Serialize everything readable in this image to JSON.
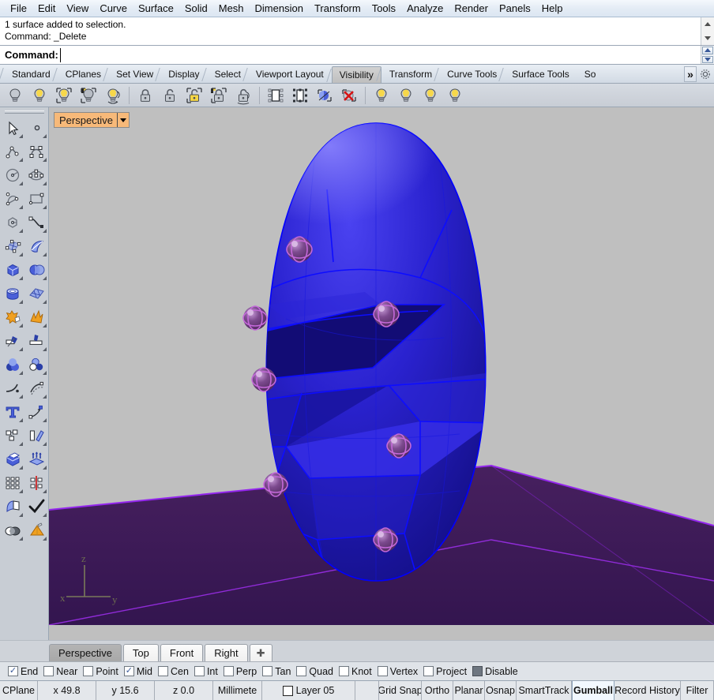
{
  "menu": {
    "items": [
      "File",
      "Edit",
      "View",
      "Curve",
      "Surface",
      "Solid",
      "Mesh",
      "Dimension",
      "Transform",
      "Tools",
      "Analyze",
      "Render",
      "Panels",
      "Help"
    ]
  },
  "command_area": {
    "history": [
      "1 surface added to selection.",
      "Command: _Delete"
    ],
    "prompt_label": "Command:",
    "input_value": "",
    "input_placeholder": "",
    "scroll_up_icon": "triangle-up-icon",
    "scroll_down_icon": "triangle-down-icon"
  },
  "toolbar_tabs": {
    "items": [
      {
        "label": "Standard",
        "active": false
      },
      {
        "label": "CPlanes",
        "active": false
      },
      {
        "label": "Set View",
        "active": false
      },
      {
        "label": "Display",
        "active": false
      },
      {
        "label": "Select",
        "active": false
      },
      {
        "label": "Viewport Layout",
        "active": false
      },
      {
        "label": "Visibility",
        "active": true
      },
      {
        "label": "Transform",
        "active": false
      },
      {
        "label": "Curve Tools",
        "active": false
      },
      {
        "label": "Surface Tools",
        "active": false
      },
      {
        "label": "So",
        "active": false,
        "clipped": true
      }
    ],
    "overflow_label": "»",
    "gear_icon": "gear-icon"
  },
  "visibility_toolbar": {
    "buttons": [
      {
        "name": "hide-objects",
        "icon": "bulb-grey-icon"
      },
      {
        "name": "show-objects",
        "icon": "bulb-yellow-icon"
      },
      {
        "name": "show-selected",
        "icon": "bulb-yellow-bracket-icon"
      },
      {
        "name": "hide-swap",
        "icon": "bulb-halfdark-icon"
      },
      {
        "name": "hide-swap-toggle",
        "icon": "bulb-swap-icon"
      },
      {
        "name": "lock-objects",
        "icon": "lock-closed-icon"
      },
      {
        "name": "unlock-objects",
        "icon": "lock-open-icon"
      },
      {
        "name": "unlock-selected",
        "icon": "lock-yellow-icon"
      },
      {
        "name": "lock-half",
        "icon": "lock-halfdark-icon"
      },
      {
        "name": "lock-swap",
        "icon": "lock-swap-icon"
      },
      {
        "name": "isolate-objects",
        "icon": "isolate-icon"
      },
      {
        "name": "unisolate-objects",
        "icon": "unisolate-icon"
      },
      {
        "name": "show-control-points",
        "icon": "points-on-icon"
      },
      {
        "name": "hide-control-points",
        "icon": "points-off-icon"
      },
      {
        "name": "bulb-extra-1",
        "icon": "bulb-yellow-icon"
      },
      {
        "name": "bulb-extra-2",
        "icon": "bulb-yellow-icon"
      },
      {
        "name": "bulb-extra-3",
        "icon": "bulb-yellow-icon"
      },
      {
        "name": "bulb-extra-4",
        "icon": "bulb-yellow-icon"
      }
    ]
  },
  "tool_palette": {
    "rows": [
      [
        {
          "name": "select-tool",
          "icon": "arrow-cursor-icon"
        },
        {
          "name": "point-tool",
          "icon": "point-icon"
        }
      ],
      [
        {
          "name": "polyline-tool",
          "icon": "polyline-icon"
        },
        {
          "name": "curve-control-points-tool",
          "icon": "nurbs-curve-icon"
        }
      ],
      [
        {
          "name": "circle-tool",
          "icon": "circle-icon"
        },
        {
          "name": "ellipse-tool",
          "icon": "ellipse-icon"
        }
      ],
      [
        {
          "name": "arc-tool",
          "icon": "arc-icon"
        },
        {
          "name": "rectangle-tool",
          "icon": "rectangle-icon"
        }
      ],
      [
        {
          "name": "polygon-tool",
          "icon": "polygon-icon"
        },
        {
          "name": "free-form-curve-tool",
          "icon": "bezier-icon"
        }
      ],
      [
        {
          "name": "surface-from-points-tool",
          "icon": "surface-points-icon"
        },
        {
          "name": "surface-sweep-tool",
          "icon": "sweep-surface-icon"
        }
      ],
      [
        {
          "name": "box-tool",
          "icon": "box-icon"
        },
        {
          "name": "sphere-boolean-tool",
          "icon": "boolean-spheres-icon"
        }
      ],
      [
        {
          "name": "cylinder-tool",
          "icon": "cylinder-icon"
        },
        {
          "name": "mesh-tool",
          "icon": "mesh-plane-icon"
        }
      ],
      [
        {
          "name": "explode-tool",
          "icon": "explode-star-icon"
        },
        {
          "name": "blast-tool",
          "icon": "blast-icon"
        }
      ],
      [
        {
          "name": "trim-tool",
          "icon": "trim-icon"
        },
        {
          "name": "split-tool",
          "icon": "split-icon"
        }
      ],
      [
        {
          "name": "boolean-union-tool",
          "icon": "boolean-union-icon"
        },
        {
          "name": "boolean-difference-tool",
          "icon": "boolean-diff-icon"
        }
      ],
      [
        {
          "name": "fillet-curve-tool",
          "icon": "fillet-curve-icon"
        },
        {
          "name": "offset-curve-tool",
          "icon": "offset-curve-icon"
        }
      ],
      [
        {
          "name": "text-tool",
          "icon": "text-t-icon"
        },
        {
          "name": "scale-tool",
          "icon": "scale-arrow-icon"
        }
      ],
      [
        {
          "name": "group-tool",
          "icon": "group-icon"
        },
        {
          "name": "mirror-tool",
          "icon": "mirror-icon"
        }
      ],
      [
        {
          "name": "cap-tool",
          "icon": "cap-solid-icon"
        },
        {
          "name": "extrude-tool",
          "icon": "extrude-up-icon"
        }
      ],
      [
        {
          "name": "array-tool",
          "icon": "array-grid-icon"
        },
        {
          "name": "array-polar-tool",
          "icon": "array-axis-icon"
        }
      ],
      [
        {
          "name": "unroll-tool",
          "icon": "unroll-surface-icon"
        },
        {
          "name": "check-tool",
          "icon": "check-mark-icon"
        }
      ],
      [
        {
          "name": "shade-tool",
          "icon": "shade-objects-icon"
        },
        {
          "name": "render-tool",
          "icon": "render-pyramid-icon"
        }
      ]
    ]
  },
  "viewport": {
    "label": "Perspective",
    "dropdown_icon": "chevron-down-icon",
    "axis_labels": {
      "x": "x",
      "y": "y",
      "z": "z"
    },
    "colors": {
      "background": "#bfbfbf",
      "ground_plane": "#3d1a5c",
      "ground_edge": "#9426ee",
      "surface_dark": "#1a16b4",
      "surface_mid": "#2a22cf",
      "surface_light": "#4038e6",
      "isocurve": "#0000ff",
      "sphere_body": "#6b3a7a",
      "sphere_ring": "#c469d9"
    },
    "model_description": "Egg-shaped NURBS surface with Voronoi cell subdivision and purple spheres"
  },
  "viewport_tabs": {
    "items": [
      {
        "label": "Perspective",
        "active": true
      },
      {
        "label": "Top",
        "active": false
      },
      {
        "label": "Front",
        "active": false
      },
      {
        "label": "Right",
        "active": false
      }
    ],
    "add_label": "✚"
  },
  "osnap_bar": {
    "items": [
      {
        "label": "End",
        "checked": true
      },
      {
        "label": "Near",
        "checked": false
      },
      {
        "label": "Point",
        "checked": false
      },
      {
        "label": "Mid",
        "checked": true
      },
      {
        "label": "Cen",
        "checked": false
      },
      {
        "label": "Int",
        "checked": false
      },
      {
        "label": "Perp",
        "checked": false
      },
      {
        "label": "Tan",
        "checked": false
      },
      {
        "label": "Quad",
        "checked": false
      },
      {
        "label": "Knot",
        "checked": false
      },
      {
        "label": "Vertex",
        "checked": false
      },
      {
        "label": "Project",
        "checked": false
      },
      {
        "label": "Disable",
        "checked": false,
        "filled": true
      }
    ],
    "check_glyph": "✓"
  },
  "status_bar": {
    "cplane_label": "CPlane",
    "x_value": "x 49.8",
    "y_value": "y 15.6",
    "z_value": "z 0.0",
    "units": "Millimete",
    "layer": "Layer 05",
    "layer_color": "#ffffff",
    "toggles": [
      {
        "label": "Grid Snap",
        "active": false
      },
      {
        "label": "Ortho",
        "active": false
      },
      {
        "label": "Planar",
        "active": false
      },
      {
        "label": "Osnap",
        "active": false
      },
      {
        "label": "SmartTrack",
        "active": false
      },
      {
        "label": "Gumball",
        "active": true
      },
      {
        "label": "Record History",
        "active": false
      },
      {
        "label": "Filter",
        "active": false
      }
    ]
  }
}
